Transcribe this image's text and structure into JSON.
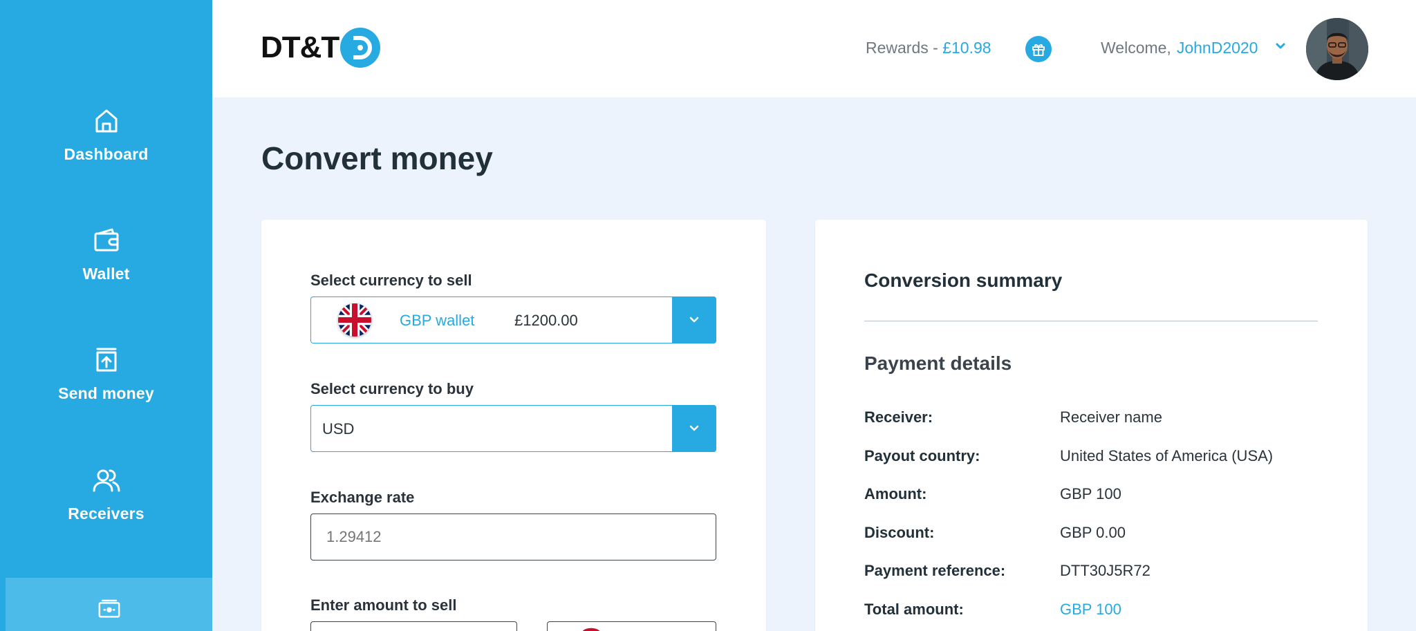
{
  "sidebar": {
    "items": [
      {
        "label": "Dashboard",
        "icon": "home-icon"
      },
      {
        "label": "Wallet",
        "icon": "wallet-icon"
      },
      {
        "label": "Send money",
        "icon": "send-money-icon"
      },
      {
        "label": "Receivers",
        "icon": "users-icon"
      },
      {
        "label": "",
        "icon": "convert-icon"
      }
    ]
  },
  "header": {
    "logo_text": "DT&T",
    "rewards_label": "Rewards - ",
    "rewards_amount": "£10.98",
    "welcome_label": "Welcome,",
    "username": "JohnD2020"
  },
  "page": {
    "title": "Convert money"
  },
  "form": {
    "sell_label": "Select currency to sell",
    "sell_wallet_name": "GBP wallet",
    "sell_wallet_amount": "£1200.00",
    "buy_label": "Select currency to buy",
    "buy_value": "USD",
    "rate_label": "Exchange rate",
    "rate_placeholder": "1.29412",
    "amount_label": "Enter amount to sell"
  },
  "summary": {
    "title": "Conversion summary",
    "section_title": "Payment details",
    "rows": [
      {
        "key": "Receiver:",
        "value": "Receiver name"
      },
      {
        "key": "Payout country:",
        "value": "United States of America (USA)"
      },
      {
        "key": "Amount:",
        "value": "GBP 100"
      },
      {
        "key": "Discount:",
        "value": "GBP 0.00"
      },
      {
        "key": "Payment reference:",
        "value": "DTT30J5R72"
      },
      {
        "key": "Total amount:",
        "value": "GBP 100"
      }
    ]
  },
  "colors": {
    "accent": "#27a9e1",
    "background": "#ecf3fc",
    "sidebar_active": "#4dbbe9"
  }
}
